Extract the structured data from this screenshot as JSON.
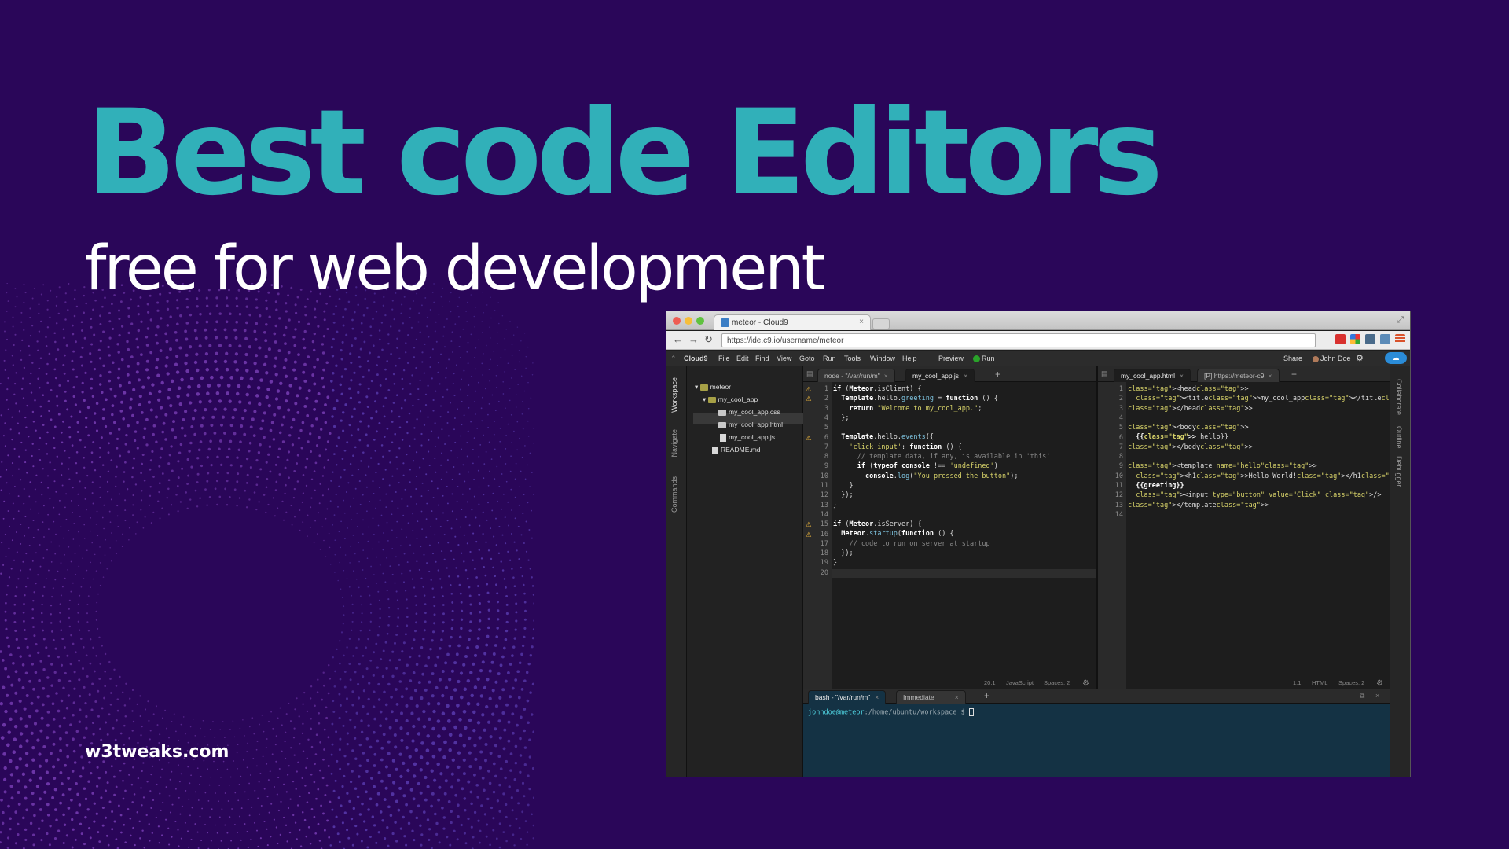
{
  "page": {
    "title": "Best code Editors",
    "subtitle": "free for web development",
    "brand": "w3tweaks.com"
  },
  "browser": {
    "tab_title": "meteor - Cloud9",
    "close_glyph": "×",
    "url": "https://ide.c9.io/username/meteor",
    "nav": {
      "back": "←",
      "forward": "→",
      "reload": "↻"
    }
  },
  "ide": {
    "menu": [
      "Cloud9",
      "File",
      "Edit",
      "Find",
      "View",
      "Goto",
      "Run",
      "Tools",
      "Window",
      "Help",
      "Preview",
      "Run"
    ],
    "share": "Share",
    "user": "John Doe",
    "left_side_tabs": [
      "Workspace",
      "Navigate",
      "Commands"
    ],
    "right_side_tabs": [
      "Collaborate",
      "Outline",
      "Debugger"
    ],
    "tree": {
      "root": "meteor",
      "folder": "my_cool_app",
      "files": [
        "my_cool_app.css",
        "my_cool_app.html",
        "my_cool_app.js"
      ],
      "readme": "README.md"
    },
    "left_tabs": [
      {
        "label": "node - \"/var/run/m\""
      },
      {
        "label": "my_cool_app.js"
      }
    ],
    "right_tabs": [
      {
        "label": "my_cool_app.html"
      },
      {
        "label": "[P] https://meteor-c9"
      }
    ],
    "left_status": {
      "pos": "20:1",
      "lang": "JavaScript",
      "spaces": "Spaces: 2"
    },
    "right_status": {
      "pos": "1:1",
      "lang": "HTML",
      "spaces": "Spaces: 2"
    },
    "terminal_tabs": [
      {
        "label": "bash - \"/var/run/m\""
      },
      {
        "label": "Immediate"
      }
    ],
    "prompt_user": "johndoe@meteor",
    "prompt_path": ":/home/ubuntu/workspace $ "
  },
  "code_js": [
    "if (Meteor.isClient) {",
    "  Template.hello.greeting = function () {",
    "    return \"Welcome to my_cool_app.\";",
    "  };",
    "",
    "  Template.hello.events({",
    "    'click input': function () {",
    "      // template data, if any, is available in 'this'",
    "      if (typeof console !== 'undefined')",
    "        console.log(\"You pressed the button\");",
    "    }",
    "  });",
    "}",
    "",
    "if (Meteor.isServer) {",
    "  Meteor.startup(function () {",
    "    // code to run on server at startup",
    "  });",
    "}",
    ""
  ],
  "code_html": [
    "<head>",
    "  <title>my_cool_app</title>",
    "</head>",
    "",
    "<body>",
    "  {{> hello}}",
    "</body>",
    "",
    "<template name=\"hello\">",
    "  <h1>Hello World!</h1>",
    "  {{greeting}}",
    "  <input type=\"button\" value=\"Click\" />",
    "</template>",
    ""
  ],
  "warnings": [
    1,
    2,
    6,
    15,
    16
  ],
  "colors": {
    "background": "#2a0659",
    "title": "#31b0b9",
    "terminal": "#143244",
    "prompt": "#4fd2e0",
    "html_tag": "#e8505a"
  },
  "icons": [
    "settings-icon",
    "cloud-icon",
    "warning-icon",
    "folder-icon",
    "file-icon",
    "plus-icon"
  ]
}
